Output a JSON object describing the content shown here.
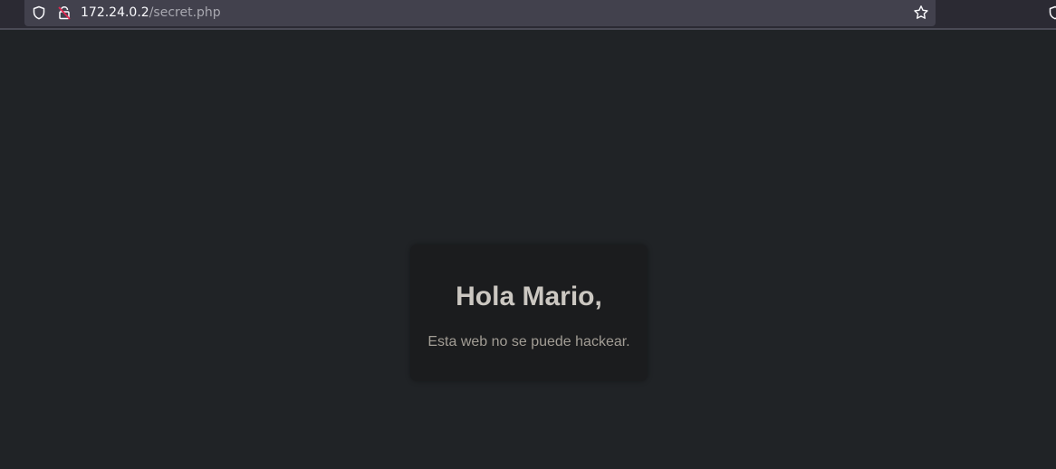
{
  "browser": {
    "url_host": "172.24.0.2",
    "url_path": "/secret.php",
    "icons": {
      "tracking_protection": "shield-icon",
      "connection": "lock-insecure-icon",
      "bookmark": "star-icon",
      "extension": "shield-icon"
    }
  },
  "page": {
    "heading": "Hola Mario,",
    "message": "Esta web no se puede hackear."
  },
  "colors": {
    "page_background": "#202326",
    "card_background": "#1b1c1e",
    "heading_color": "#cbc7c1",
    "message_color": "#a29d95"
  }
}
